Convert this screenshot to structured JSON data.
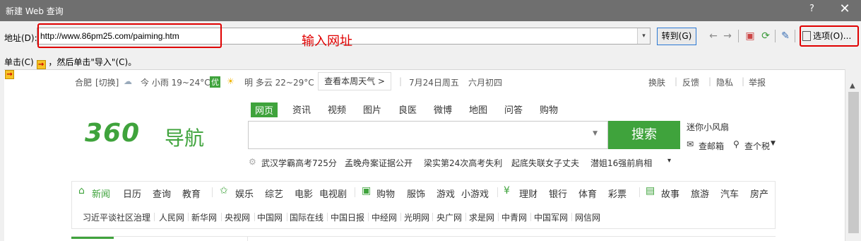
{
  "window": {
    "title": "新建 Web 查询",
    "help": "?",
    "close": "✕"
  },
  "address": {
    "label": "地址(D):",
    "value": "http://www.86pm25.com/paiming.htm",
    "annotation": "输入网址",
    "go_label": "转到(G)"
  },
  "options_label": "选项(O)...",
  "instruction": {
    "prefix": "单击(C)",
    "suffix": "，然后单击\"导入\"(C)。"
  },
  "accent_color": "#3fa33c",
  "highlight_color": "#e00000",
  "weather": {
    "city": "合肥",
    "switch": "[切换]",
    "today": "今 小雨 19~24°C",
    "badge": "优",
    "tomorrow": "明 多云 22~29°C",
    "week_button": "查看本周天气 >",
    "date": "7月24日周五",
    "lunar": "六月初四",
    "links": [
      "换肤",
      "反馈",
      "隐私",
      "举报"
    ]
  },
  "logo": {
    "text": "360",
    "sub": "导航"
  },
  "search_tabs": [
    "网页",
    "资讯",
    "视频",
    "图片",
    "良医",
    "微博",
    "地图",
    "问答",
    "购物"
  ],
  "search_button": "搜索",
  "side": {
    "fan": "迷你小风扇",
    "mail": "查邮箱",
    "tax": "查个税"
  },
  "hot_items": [
    "武汉学霸高考725分",
    "孟晚舟案证据公开",
    "梁实第24次高考失利",
    "起底失联女子丈夫",
    "潜姐16强前肩相"
  ],
  "categories": [
    "新闻",
    "日历",
    "查询",
    "教育",
    "娱乐",
    "综艺",
    "电影",
    "电视剧",
    "购物",
    "服饰",
    "游戏",
    "小游戏",
    "理财",
    "银行",
    "体育",
    "彩票",
    "故事",
    "旅游",
    "汽车",
    "房产"
  ],
  "links_row": [
    "习近平谈社区治理",
    "人民网",
    "新华网",
    "央视网",
    "中国网",
    "国际在线",
    "中国日报",
    "中经网",
    "光明网",
    "央广网",
    "求是网",
    "中青网",
    "中国军网",
    "网信网"
  ]
}
